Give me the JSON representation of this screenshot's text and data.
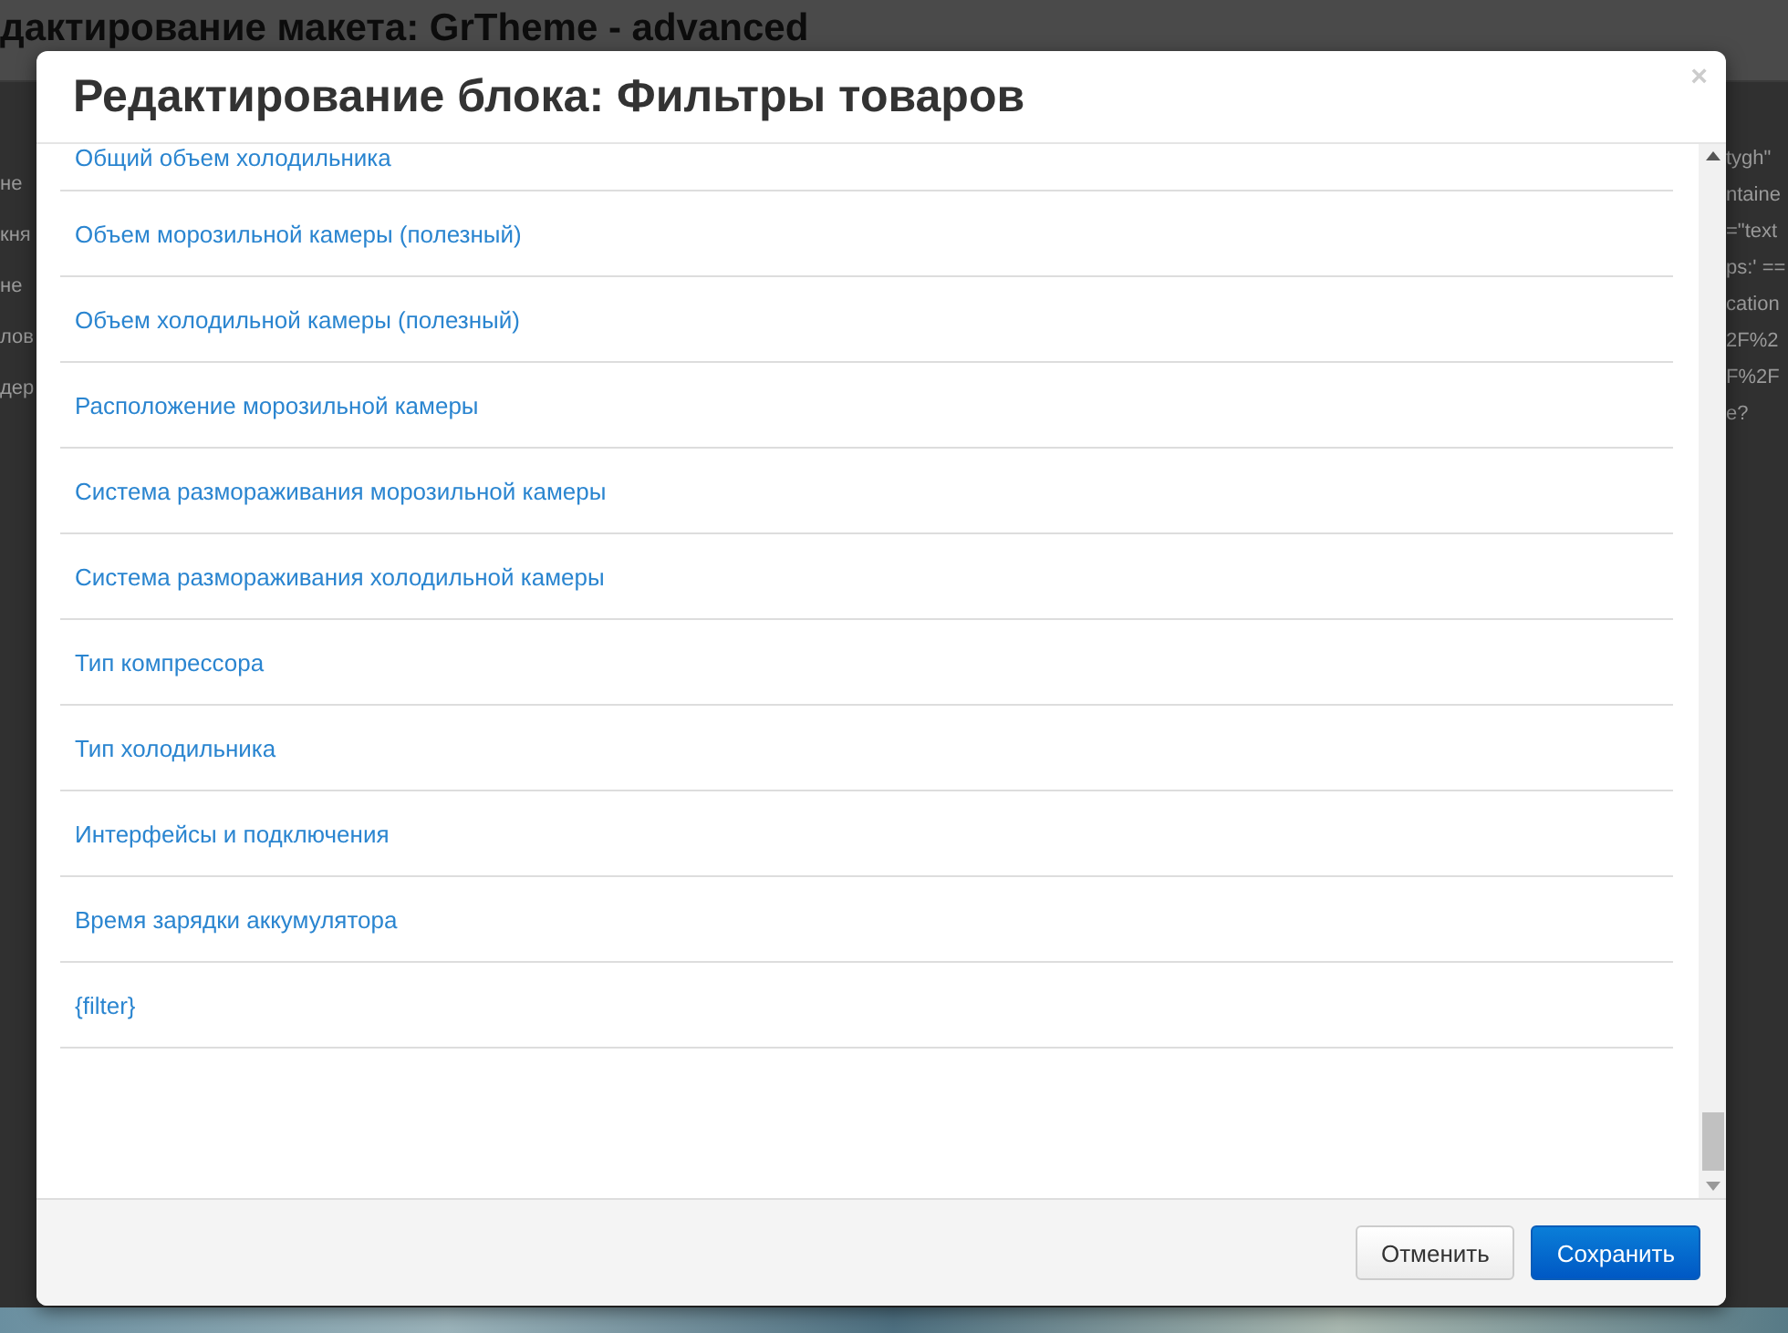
{
  "background_page": {
    "title": "дактирование макета: GrTheme - advanced",
    "left_fragments": [
      "не",
      "кня",
      "не",
      "лов",
      "дер"
    ],
    "right_fragments": [
      "tygh\"",
      "ntaine",
      "=\"text",
      "ps:' ==",
      "cation",
      "2F%2",
      "F%2F",
      "e?"
    ]
  },
  "dialog": {
    "title": "Редактирование блока: Фильтры товаров",
    "close": "×",
    "items": [
      "Общий объем холодильника",
      "Объем морозильной камеры (полезный)",
      "Объем холодильной камеры (полезный)",
      "Расположение морозильной камеры",
      "Система размораживания морозильной камеры",
      "Система размораживания холодильной камеры",
      "Тип компрессора",
      "Тип холодильника",
      "Интерфейсы и подключения",
      "Время зарядки аккумулятора",
      "{filter}"
    ],
    "buttons": [
      {
        "label": "Отменить",
        "kind": "secondary"
      },
      {
        "label": "Сохранить",
        "kind": "primary"
      }
    ]
  }
}
